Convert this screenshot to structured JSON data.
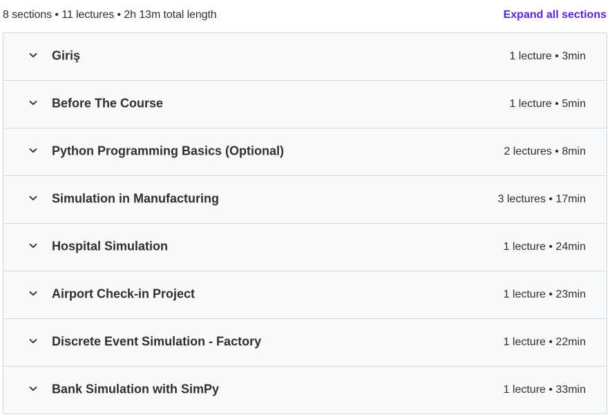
{
  "summary": {
    "text": "8 sections • 11 lectures • 2h 13m total length",
    "expand_label": "Expand all sections"
  },
  "colors": {
    "accent": "#5624d0",
    "section_bg": "#f7f9fa",
    "border": "#d1d7dc",
    "text": "#2d2f31"
  },
  "sections": [
    {
      "title": "Giriş",
      "meta": "1 lecture • 3min",
      "icon": "chevron-down-icon"
    },
    {
      "title": "Before The Course",
      "meta": "1 lecture • 5min",
      "icon": "chevron-down-icon"
    },
    {
      "title": "Python Programming Basics (Optional)",
      "meta": "2 lectures • 8min",
      "icon": "chevron-down-icon"
    },
    {
      "title": "Simulation in Manufacturing",
      "meta": "3 lectures • 17min",
      "icon": "chevron-down-icon"
    },
    {
      "title": "Hospital Simulation",
      "meta": "1 lecture • 24min",
      "icon": "chevron-down-icon"
    },
    {
      "title": "Airport Check-in Project",
      "meta": "1 lecture • 23min",
      "icon": "chevron-down-icon"
    },
    {
      "title": "Discrete Event Simulation - Factory",
      "meta": "1 lecture • 22min",
      "icon": "chevron-down-icon"
    },
    {
      "title": "Bank Simulation with SimPy",
      "meta": "1 lecture • 33min",
      "icon": "chevron-down-icon"
    }
  ]
}
